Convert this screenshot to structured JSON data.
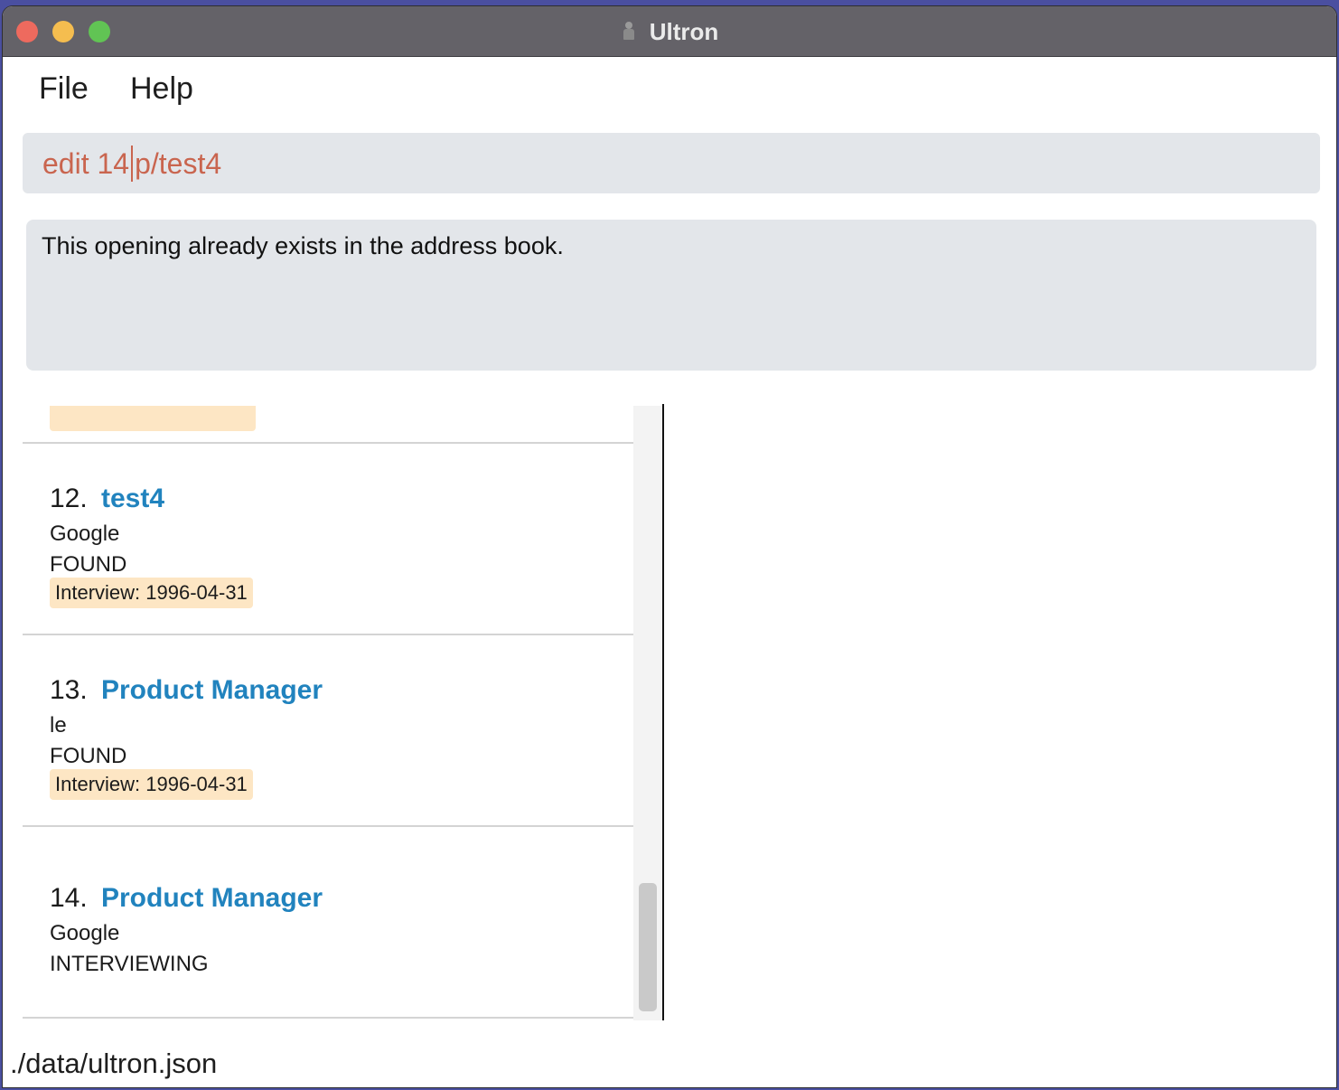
{
  "window": {
    "title": "Ultron",
    "icon": "robot-icon"
  },
  "menu": {
    "file": "File",
    "help": "Help"
  },
  "command": {
    "before_caret": "edit 14",
    "after_caret": "p/test4"
  },
  "result": {
    "message": "This opening already exists in the address book."
  },
  "openings": [
    {
      "index": "12.",
      "role": "test4",
      "company": "Google",
      "status": "FOUND",
      "tag": "Interview: 1996-04-31"
    },
    {
      "index": "13.",
      "role": "Product Manager",
      "company": "le",
      "status": "FOUND",
      "tag": "Interview: 1996-04-31"
    },
    {
      "index": "14.",
      "role": "Product Manager",
      "company": "Google",
      "status": "INTERVIEWING",
      "tag": ""
    }
  ],
  "statusbar": {
    "path": "./data/ultron.json"
  },
  "colors": {
    "accent": "#2183be",
    "command_text": "#c9654f",
    "tag_bg": "#fde6c4"
  }
}
